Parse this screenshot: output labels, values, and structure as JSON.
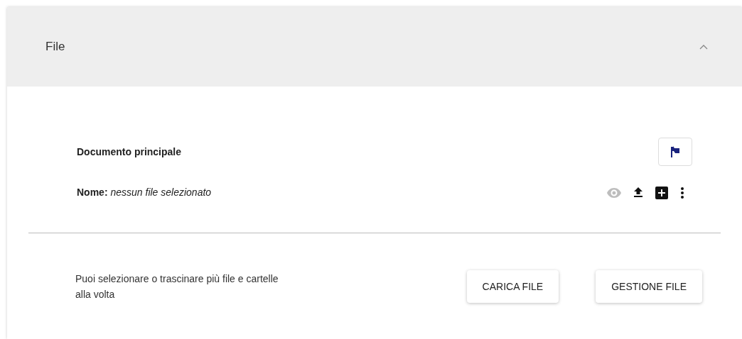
{
  "panel": {
    "title": "File",
    "expanded": true
  },
  "document": {
    "heading": "Documento principale",
    "name_label": "Nome:",
    "name_value": "nessun file selezionato",
    "actions": [
      {
        "kind": "view",
        "disabled": true
      },
      {
        "kind": "upload",
        "disabled": false
      },
      {
        "kind": "add",
        "disabled": false
      },
      {
        "kind": "more",
        "disabled": false
      }
    ]
  },
  "hint": "Puoi selezionare o trascinare più file e cartelle alla volta",
  "buttons": [
    "CARICA FILE",
    "GESTIONE FILE"
  ]
}
